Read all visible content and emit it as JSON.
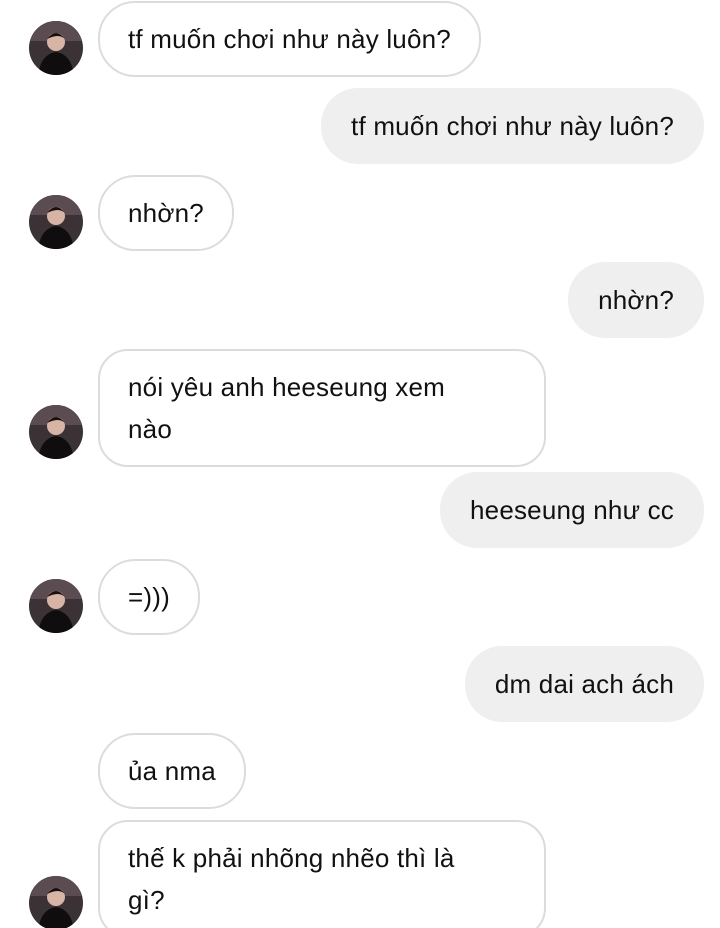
{
  "messages": [
    {
      "side": "in",
      "text": "tf muốn chơi như này luôn?",
      "avatar": true
    },
    {
      "side": "out",
      "text": "tf muốn chơi như này luôn?"
    },
    {
      "side": "in",
      "text": "nhờn?",
      "avatar": true
    },
    {
      "side": "out",
      "text": "nhờn?"
    },
    {
      "side": "in",
      "text": "nói yêu anh heeseung xem\nnào",
      "avatar": true
    },
    {
      "side": "out",
      "text": "heeseung như cc"
    },
    {
      "side": "in",
      "text": "=)))",
      "avatar": true
    },
    {
      "side": "out",
      "text": "dm dai ach ách"
    },
    {
      "side": "in",
      "text": "ủa nma",
      "avatar": false
    },
    {
      "side": "in",
      "text": "thế k phải nhõng nhẽo thì là\ngì?",
      "avatar": true
    }
  ],
  "colors": {
    "outgoing_bubble": "#efefef",
    "incoming_border": "#dcdcdc",
    "text": "#111111"
  },
  "icons": {
    "avatar": "profile-photo-avatar-icon"
  }
}
